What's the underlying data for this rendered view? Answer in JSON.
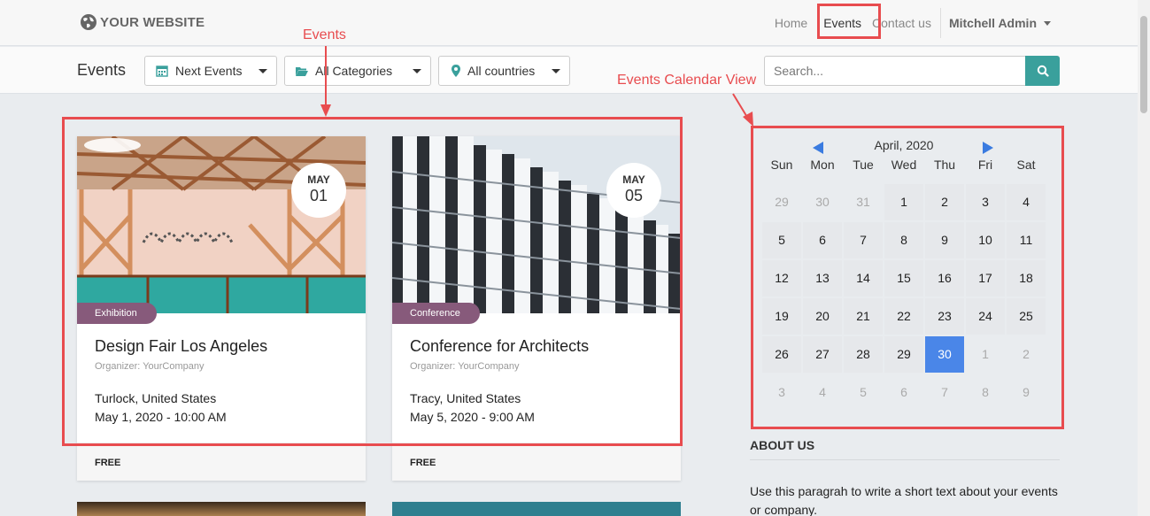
{
  "header": {
    "logo_text": "YOUR WEBSITE",
    "nav": [
      "Home",
      "Events",
      "Contact us"
    ],
    "user": "Mitchell Admin"
  },
  "filters": {
    "title": "Events",
    "time": "Next Events",
    "category": "All Categories",
    "country": "All countries",
    "search_placeholder": "Search..."
  },
  "events": [
    {
      "month": "MAY",
      "day": "01",
      "tag": "Exhibition",
      "title": "Design Fair Los Angeles",
      "organizer": "Organizer: YourCompany",
      "location": "Turlock, United States",
      "datetime": "May 1, 2020 - 10:00 AM",
      "price": "FREE"
    },
    {
      "month": "MAY",
      "day": "05",
      "tag": "Conference",
      "title": "Conference for Architects",
      "organizer": "Organizer: YourCompany",
      "location": "Tracy, United States",
      "datetime": "May 5, 2020 - 9:00 AM",
      "price": "FREE"
    }
  ],
  "calendar": {
    "title": "April, 2020",
    "weekdays": [
      "Sun",
      "Mon",
      "Tue",
      "Wed",
      "Thu",
      "Fri",
      "Sat"
    ],
    "weeks": [
      [
        "29",
        "30",
        "31",
        "1",
        "2",
        "3",
        "4"
      ],
      [
        "5",
        "6",
        "7",
        "8",
        "9",
        "10",
        "11"
      ],
      [
        "12",
        "13",
        "14",
        "15",
        "16",
        "17",
        "18"
      ],
      [
        "19",
        "20",
        "21",
        "22",
        "23",
        "24",
        "25"
      ],
      [
        "26",
        "27",
        "28",
        "29",
        "30",
        "1",
        "2"
      ],
      [
        "3",
        "4",
        "5",
        "6",
        "7",
        "8",
        "9"
      ]
    ],
    "today": "30"
  },
  "about": {
    "heading": "ABOUT US",
    "text": "Use this paragrah to write a short text about your events or company."
  },
  "annotations": {
    "events": "Events",
    "calendar": "Events Calendar View"
  },
  "colors": {
    "accent": "#3aa09c",
    "tag": "#875a7b",
    "today": "#4a86e8",
    "annotation": "#e84c4f"
  }
}
